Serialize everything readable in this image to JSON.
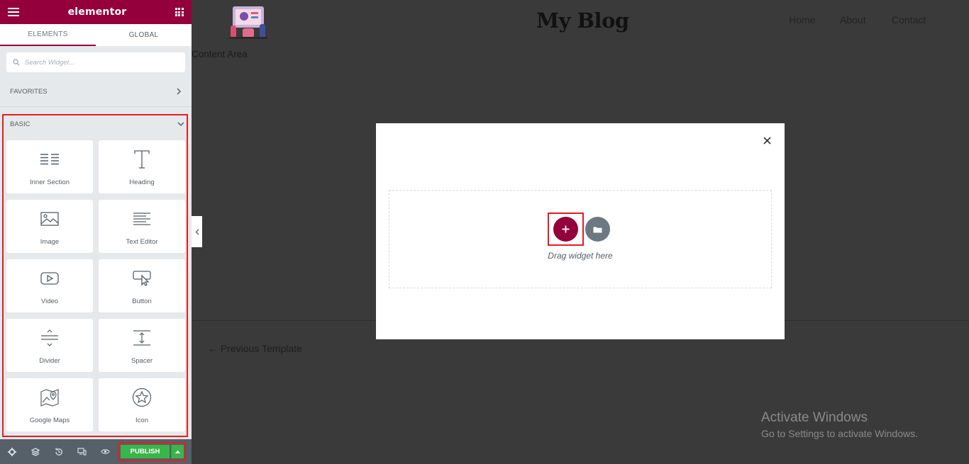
{
  "sidebar": {
    "brand": "elementor",
    "tabs": [
      {
        "label": "ELEMENTS",
        "active": true
      },
      {
        "label": "GLOBAL",
        "active": false
      }
    ],
    "search_placeholder": "Search Widget...",
    "favorites_label": "FAVORITES",
    "basic_label": "BASIC",
    "widgets": [
      {
        "label": "Inner Section",
        "icon": "inner-section-icon"
      },
      {
        "label": "Heading",
        "icon": "heading-icon"
      },
      {
        "label": "Image",
        "icon": "image-icon"
      },
      {
        "label": "Text Editor",
        "icon": "text-editor-icon"
      },
      {
        "label": "Video",
        "icon": "video-icon"
      },
      {
        "label": "Button",
        "icon": "button-icon"
      },
      {
        "label": "Divider",
        "icon": "divider-icon"
      },
      {
        "label": "Spacer",
        "icon": "spacer-icon"
      },
      {
        "label": "Google Maps",
        "icon": "google-maps-icon"
      },
      {
        "label": "Icon",
        "icon": "star-icon"
      }
    ],
    "footer": {
      "publish_label": "PUBLISH",
      "icons": [
        "settings-icon",
        "navigator-layers-icon",
        "history-icon",
        "responsive-icon",
        "preview-eye-icon"
      ]
    }
  },
  "preview": {
    "site_title": "My Blog",
    "nav": [
      "Home",
      "About",
      "Contact"
    ],
    "content_area_label": "Content Area",
    "previous_link": "← Previous Template"
  },
  "modal": {
    "drag_text": "Drag widget here"
  },
  "watermark": {
    "title": "Activate Windows",
    "subtitle": "Go to Settings to activate Windows."
  },
  "colors": {
    "brand": "#93003c",
    "publish": "#39b54a",
    "highlight": "#e51c23",
    "sidebar_bg": "#e6e9ec",
    "preview_bg": "#3a3a3a"
  }
}
